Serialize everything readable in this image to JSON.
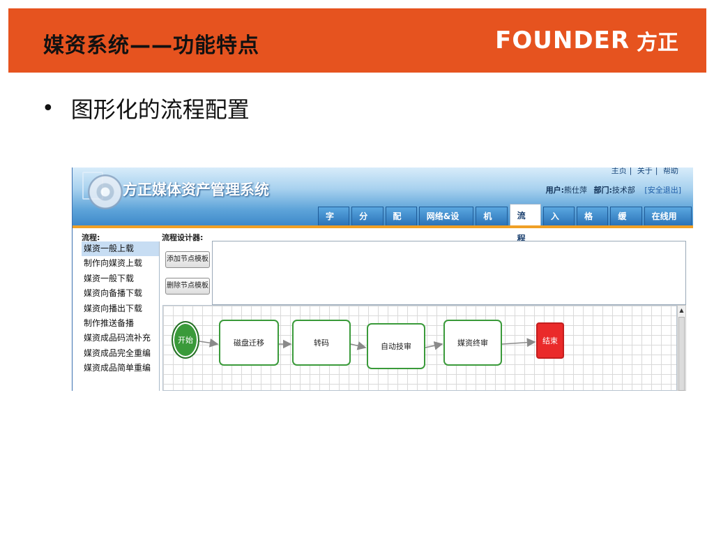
{
  "slide": {
    "title": "媒资系统——功能特点",
    "logo_en": "FOUNDER",
    "logo_cn": "方正",
    "bullet_symbol": "•",
    "bullet_text": "图形化的流程配置"
  },
  "app": {
    "title": "方正媒体资产管理系统",
    "top_links": [
      "主页",
      "关于",
      "帮助"
    ],
    "user_label": "用户:",
    "user_name": "熊仕萍",
    "dept_label": "部门:",
    "dept_name": "技术部",
    "logout": "[安全退出]",
    "tabs": [
      {
        "label": "字典",
        "active": false
      },
      {
        "label": "分类",
        "active": false
      },
      {
        "label": "配置",
        "active": false
      },
      {
        "label": "网络&设备",
        "active": false
      },
      {
        "label": "机构",
        "active": false
      },
      {
        "label": "流程",
        "active": true
      },
      {
        "label": "入口",
        "active": false
      },
      {
        "label": "格式",
        "active": false
      },
      {
        "label": "缓存",
        "active": false
      },
      {
        "label": "在线用户",
        "active": false
      }
    ],
    "sidebar_title": "流程:",
    "sidebar_items": [
      {
        "label": "媒资一般上载",
        "selected": true
      },
      {
        "label": "制作向媒资上载",
        "selected": false
      },
      {
        "label": "媒资一般下载",
        "selected": false
      },
      {
        "label": "媒资向备播下载",
        "selected": false
      },
      {
        "label": "媒资向播出下载",
        "selected": false
      },
      {
        "label": "制作推送备播",
        "selected": false
      },
      {
        "label": "媒资成品码流补充",
        "selected": false
      },
      {
        "label": "媒资成品完全重编",
        "selected": false
      },
      {
        "label": "媒资成品简单重编",
        "selected": false
      }
    ],
    "designer_title": "流程设计器:",
    "add_button": "添加节点模板",
    "delete_button": "删除节点模板",
    "flow_nodes": [
      {
        "label": "开始",
        "kind": "start"
      },
      {
        "label": "磁盘迁移",
        "kind": "step"
      },
      {
        "label": "转码",
        "kind": "step"
      },
      {
        "label": "自动技审",
        "kind": "step"
      },
      {
        "label": "媒资终审",
        "kind": "step"
      },
      {
        "label": "结束",
        "kind": "end"
      }
    ],
    "colors": {
      "step_border": "#3a9a3a",
      "start_fill": "#3a9a3a",
      "end_fill": "#ea2a2a",
      "header_orange": "#e6531f"
    }
  }
}
